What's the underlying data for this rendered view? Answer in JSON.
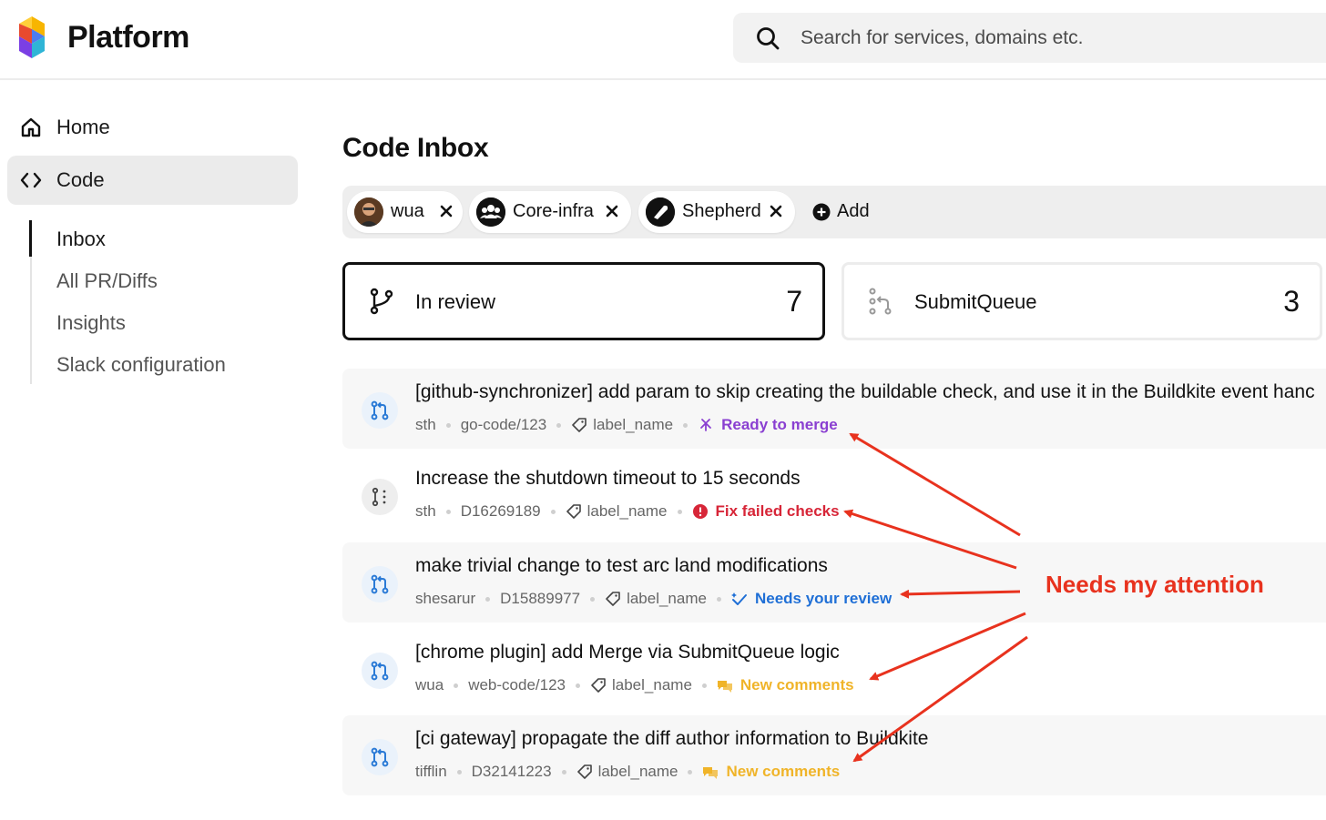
{
  "header": {
    "app_title": "Platform",
    "search_placeholder": "Search for services, domains etc.",
    "logo_icon": "platform-cube-logo",
    "search_icon": "search-icon"
  },
  "sidebar": {
    "items": [
      {
        "label": "Home",
        "icon": "home-icon",
        "active": false
      },
      {
        "label": "Code",
        "icon": "code-brackets-icon",
        "active": true
      }
    ],
    "subitems": [
      {
        "label": "Inbox",
        "active": true
      },
      {
        "label": "All PR/Diffs",
        "active": false
      },
      {
        "label": "Insights",
        "active": false
      },
      {
        "label": "Slack configuration",
        "active": false
      }
    ]
  },
  "main": {
    "title": "Code Inbox",
    "filters": [
      {
        "label": "wua",
        "icon": "user-avatar"
      },
      {
        "label": "Core-infra",
        "icon": "group-icon"
      },
      {
        "label": "Shepherd",
        "icon": "shepherd-icon"
      }
    ],
    "add_label": "Add",
    "tabs": [
      {
        "label": "In review",
        "count": "7",
        "icon": "branch-icon",
        "selected": true
      },
      {
        "label": "SubmitQueue",
        "count": "3",
        "icon": "merge-queue-icon",
        "selected": false
      }
    ],
    "rows": [
      {
        "title": "[github-synchronizer] add param to skip creating the buildable check, and use it in the Buildkite event hanc",
        "author": "sth",
        "ref": "go-code/123",
        "label": "label_name",
        "status": "Ready to merge",
        "status_color": "#8a3fd1",
        "icon": "pull-request-icon"
      },
      {
        "title": "Increase the shutdown timeout to 15 seconds",
        "author": "sth",
        "ref": "D16269189",
        "label": "label_name",
        "status": "Fix failed checks",
        "status_color": "#d72638",
        "icon": "diff-icon"
      },
      {
        "title": "make trivial change to test arc land modifications",
        "author": "shesarur",
        "ref": "D15889977",
        "label": "label_name",
        "status": "Needs your review",
        "status_color": "#1f6fd6",
        "icon": "pull-request-icon"
      },
      {
        "title": "[chrome plugin] add Merge via SubmitQueue logic",
        "author": "wua",
        "ref": "web-code/123",
        "label": "label_name",
        "status": "New comments",
        "status_color": "#f0b429",
        "icon": "pull-request-icon"
      },
      {
        "title": "[ci gateway] propagate the diff author information to Buildkite",
        "author": "tifflin",
        "ref": "D32141223",
        "label": "label_name",
        "status": "New comments",
        "status_color": "#f0b429",
        "icon": "pull-request-icon"
      }
    ]
  },
  "annotation": {
    "text": "Needs my attention",
    "color": "#e8321e"
  }
}
